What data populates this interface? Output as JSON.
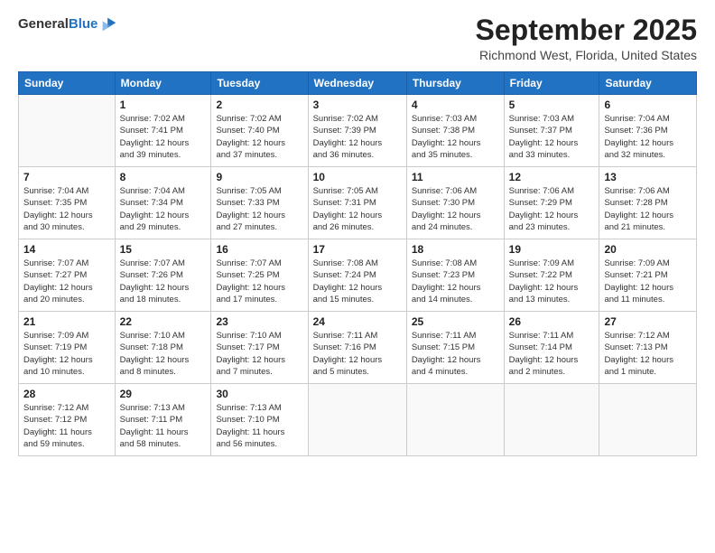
{
  "logo": {
    "general": "General",
    "blue": "Blue"
  },
  "title": "September 2025",
  "location": "Richmond West, Florida, United States",
  "weekdays": [
    "Sunday",
    "Monday",
    "Tuesday",
    "Wednesday",
    "Thursday",
    "Friday",
    "Saturday"
  ],
  "weeks": [
    [
      {
        "day": "",
        "info": ""
      },
      {
        "day": "1",
        "info": "Sunrise: 7:02 AM\nSunset: 7:41 PM\nDaylight: 12 hours\nand 39 minutes."
      },
      {
        "day": "2",
        "info": "Sunrise: 7:02 AM\nSunset: 7:40 PM\nDaylight: 12 hours\nand 37 minutes."
      },
      {
        "day": "3",
        "info": "Sunrise: 7:02 AM\nSunset: 7:39 PM\nDaylight: 12 hours\nand 36 minutes."
      },
      {
        "day": "4",
        "info": "Sunrise: 7:03 AM\nSunset: 7:38 PM\nDaylight: 12 hours\nand 35 minutes."
      },
      {
        "day": "5",
        "info": "Sunrise: 7:03 AM\nSunset: 7:37 PM\nDaylight: 12 hours\nand 33 minutes."
      },
      {
        "day": "6",
        "info": "Sunrise: 7:04 AM\nSunset: 7:36 PM\nDaylight: 12 hours\nand 32 minutes."
      }
    ],
    [
      {
        "day": "7",
        "info": "Sunrise: 7:04 AM\nSunset: 7:35 PM\nDaylight: 12 hours\nand 30 minutes."
      },
      {
        "day": "8",
        "info": "Sunrise: 7:04 AM\nSunset: 7:34 PM\nDaylight: 12 hours\nand 29 minutes."
      },
      {
        "day": "9",
        "info": "Sunrise: 7:05 AM\nSunset: 7:33 PM\nDaylight: 12 hours\nand 27 minutes."
      },
      {
        "day": "10",
        "info": "Sunrise: 7:05 AM\nSunset: 7:31 PM\nDaylight: 12 hours\nand 26 minutes."
      },
      {
        "day": "11",
        "info": "Sunrise: 7:06 AM\nSunset: 7:30 PM\nDaylight: 12 hours\nand 24 minutes."
      },
      {
        "day": "12",
        "info": "Sunrise: 7:06 AM\nSunset: 7:29 PM\nDaylight: 12 hours\nand 23 minutes."
      },
      {
        "day": "13",
        "info": "Sunrise: 7:06 AM\nSunset: 7:28 PM\nDaylight: 12 hours\nand 21 minutes."
      }
    ],
    [
      {
        "day": "14",
        "info": "Sunrise: 7:07 AM\nSunset: 7:27 PM\nDaylight: 12 hours\nand 20 minutes."
      },
      {
        "day": "15",
        "info": "Sunrise: 7:07 AM\nSunset: 7:26 PM\nDaylight: 12 hours\nand 18 minutes."
      },
      {
        "day": "16",
        "info": "Sunrise: 7:07 AM\nSunset: 7:25 PM\nDaylight: 12 hours\nand 17 minutes."
      },
      {
        "day": "17",
        "info": "Sunrise: 7:08 AM\nSunset: 7:24 PM\nDaylight: 12 hours\nand 15 minutes."
      },
      {
        "day": "18",
        "info": "Sunrise: 7:08 AM\nSunset: 7:23 PM\nDaylight: 12 hours\nand 14 minutes."
      },
      {
        "day": "19",
        "info": "Sunrise: 7:09 AM\nSunset: 7:22 PM\nDaylight: 12 hours\nand 13 minutes."
      },
      {
        "day": "20",
        "info": "Sunrise: 7:09 AM\nSunset: 7:21 PM\nDaylight: 12 hours\nand 11 minutes."
      }
    ],
    [
      {
        "day": "21",
        "info": "Sunrise: 7:09 AM\nSunset: 7:19 PM\nDaylight: 12 hours\nand 10 minutes."
      },
      {
        "day": "22",
        "info": "Sunrise: 7:10 AM\nSunset: 7:18 PM\nDaylight: 12 hours\nand 8 minutes."
      },
      {
        "day": "23",
        "info": "Sunrise: 7:10 AM\nSunset: 7:17 PM\nDaylight: 12 hours\nand 7 minutes."
      },
      {
        "day": "24",
        "info": "Sunrise: 7:11 AM\nSunset: 7:16 PM\nDaylight: 12 hours\nand 5 minutes."
      },
      {
        "day": "25",
        "info": "Sunrise: 7:11 AM\nSunset: 7:15 PM\nDaylight: 12 hours\nand 4 minutes."
      },
      {
        "day": "26",
        "info": "Sunrise: 7:11 AM\nSunset: 7:14 PM\nDaylight: 12 hours\nand 2 minutes."
      },
      {
        "day": "27",
        "info": "Sunrise: 7:12 AM\nSunset: 7:13 PM\nDaylight: 12 hours\nand 1 minute."
      }
    ],
    [
      {
        "day": "28",
        "info": "Sunrise: 7:12 AM\nSunset: 7:12 PM\nDaylight: 11 hours\nand 59 minutes."
      },
      {
        "day": "29",
        "info": "Sunrise: 7:13 AM\nSunset: 7:11 PM\nDaylight: 11 hours\nand 58 minutes."
      },
      {
        "day": "30",
        "info": "Sunrise: 7:13 AM\nSunset: 7:10 PM\nDaylight: 11 hours\nand 56 minutes."
      },
      {
        "day": "",
        "info": ""
      },
      {
        "day": "",
        "info": ""
      },
      {
        "day": "",
        "info": ""
      },
      {
        "day": "",
        "info": ""
      }
    ]
  ]
}
